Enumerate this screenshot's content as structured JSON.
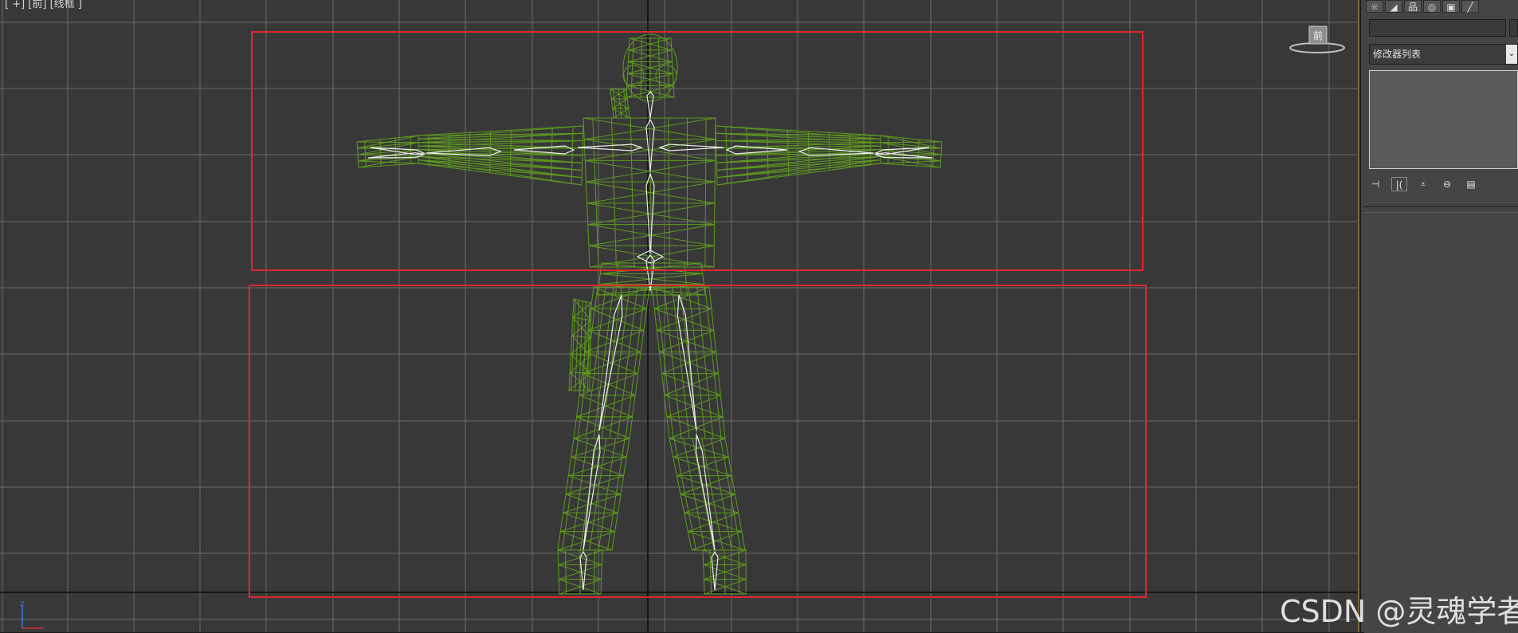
{
  "viewport": {
    "label": "[ +] [前] [线框 ]",
    "viewcube_label": "前"
  },
  "command_panel": {
    "tabs": [
      "☼",
      "◢",
      "品",
      "◎",
      "▣",
      "╱"
    ],
    "name_value": "",
    "modifier_list_label": "修改器列表",
    "stack_tools": [
      "⊣",
      "|(",
      "⩡",
      "⊖",
      "▤"
    ]
  },
  "watermark": "CSDN @灵魂学者",
  "colors": {
    "viewport_bg": "#383838",
    "grid": "#6a6a6a",
    "grid_axis": "#0a0a0a",
    "mesh": "#5d9a1e",
    "bones": "#ececec",
    "highlight_box": "#e0282c"
  }
}
